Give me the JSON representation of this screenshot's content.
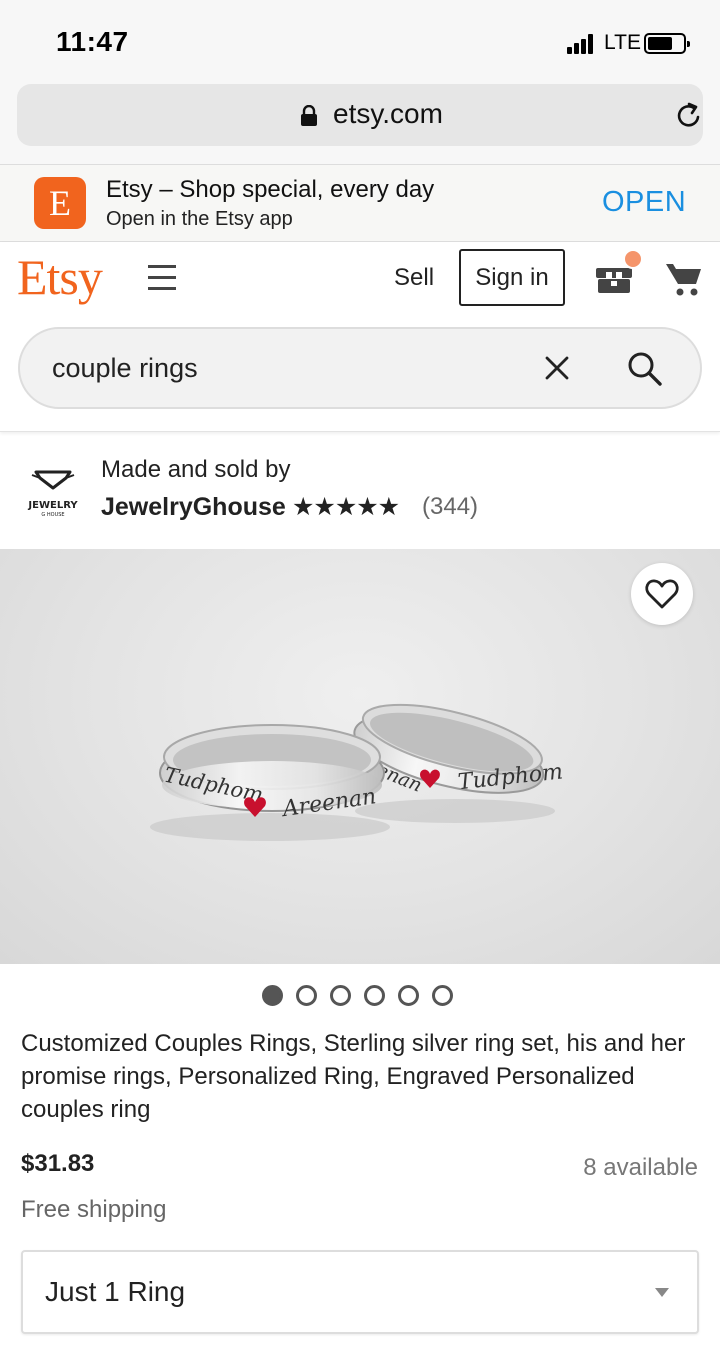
{
  "status_bar": {
    "time": "11:47",
    "network": "LTE"
  },
  "browser": {
    "url": "etsy.com"
  },
  "app_banner": {
    "icon_letter": "E",
    "title": "Etsy – Shop special, every day",
    "subtitle": "Open in the Etsy app",
    "open_label": "OPEN"
  },
  "header": {
    "logo": "Etsy",
    "sell_label": "Sell",
    "sign_in_label": "Sign in",
    "search_value": "couple rings",
    "accent_color": "#f1641e"
  },
  "seller": {
    "made_by": "Made and sold by",
    "shop_name": "JewelryGhouse",
    "stars": "★★★★★",
    "rating": 5,
    "review_count": "(344)",
    "logo_text": "JEWELRY",
    "logo_subtext": "G HOUSE"
  },
  "product": {
    "engraving_left": [
      "Tudphom",
      "Areenan"
    ],
    "engraving_right": [
      "Areenan",
      "Tudphom"
    ],
    "image_count": 6,
    "active_image": 1,
    "title": "Customized Couples Rings, Sterling silver ring set, his and her promise rings, Personalized Ring, Engraved Personalized couples ring",
    "price": "$31.83",
    "availability": "8 available",
    "shipping": "Free shipping",
    "variation_selected": "Just 1 Ring"
  }
}
